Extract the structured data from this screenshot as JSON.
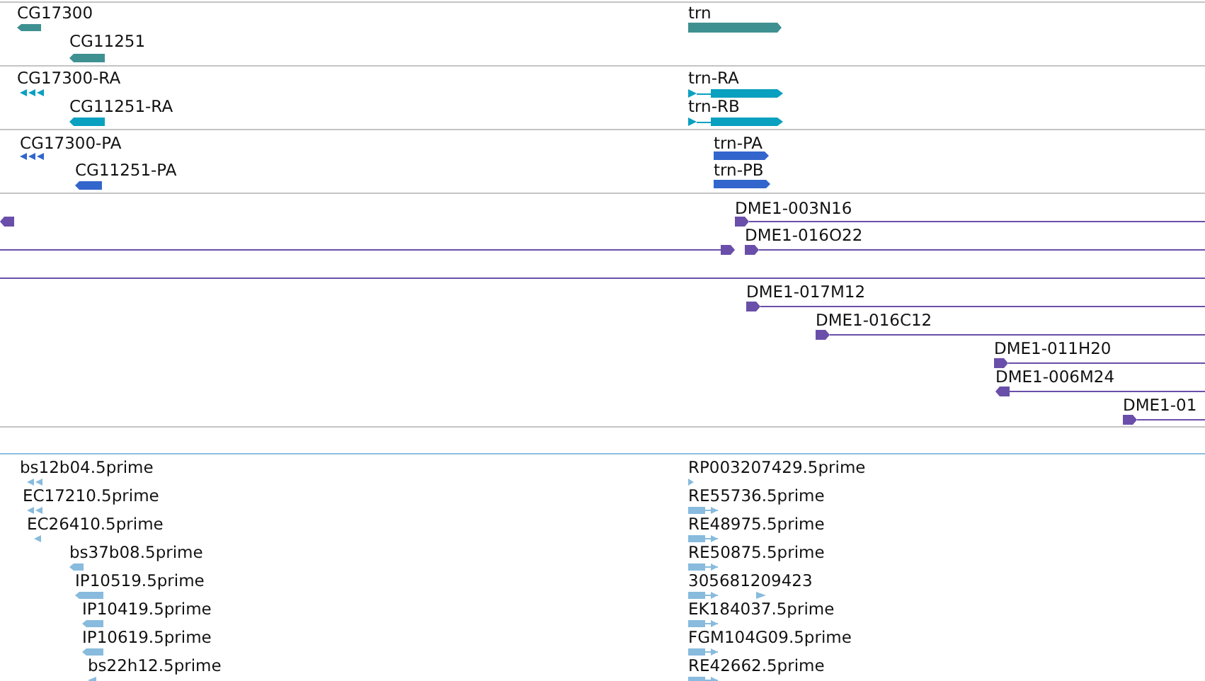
{
  "tracks": [
    {
      "kind": "gene",
      "features": [
        {
          "label": "CG17300",
          "reverse": true
        },
        {
          "label": "CG11251",
          "reverse": true
        },
        {
          "label": "trn",
          "reverse": false
        }
      ]
    },
    {
      "kind": "mrna",
      "features": [
        {
          "label": "CG17300-RA",
          "reverse": true
        },
        {
          "label": "CG11251-RA",
          "reverse": true
        },
        {
          "label": "trn-RA",
          "reverse": false
        },
        {
          "label": "trn-RB",
          "reverse": false
        }
      ]
    },
    {
      "kind": "protein",
      "features": [
        {
          "label": "CG17300-PA",
          "reverse": true
        },
        {
          "label": "CG11251-PA",
          "reverse": true
        },
        {
          "label": "trn-PA",
          "reverse": false
        },
        {
          "label": "trn-PB",
          "reverse": false
        }
      ]
    },
    {
      "kind": "clone",
      "features": [
        {
          "reverse": true
        },
        {
          "label": "DME1-003N16",
          "reverse": false
        },
        {
          "reverse": false
        },
        {
          "label": "DME1-016O22",
          "reverse": false
        },
        {
          "arrow": false
        },
        {
          "label": "DME1-017M12",
          "reverse": false
        },
        {
          "label": "DME1-016C12",
          "reverse": false
        },
        {
          "label": "DME1-011H20",
          "reverse": false
        },
        {
          "label": "DME1-006M24",
          "reverse": true
        },
        {
          "label": "DME1-01",
          "reverse": false
        }
      ]
    },
    {
      "kind": "est",
      "features": [
        {
          "label": "bs12b04.5prime",
          "reverse": true
        },
        {
          "label": "EC17210.5prime",
          "reverse": true
        },
        {
          "label": "EC26410.5prime",
          "reverse": true
        },
        {
          "label": "bs37b08.5prime",
          "reverse": true
        },
        {
          "label": "IP10519.5prime",
          "reverse": true
        },
        {
          "label": "IP10419.5prime",
          "reverse": true
        },
        {
          "label": "IP10619.5prime",
          "reverse": true
        },
        {
          "label": "bs22h12.5prime",
          "reverse": true
        },
        {
          "label": "RP003207429.5prime",
          "reverse": false
        },
        {
          "label": "RE55736.5prime",
          "reverse": false
        },
        {
          "label": "RE48975.5prime",
          "reverse": false
        },
        {
          "label": "RE50875.5prime",
          "reverse": false
        },
        {
          "label": "305681209423",
          "reverse": false
        },
        {
          "label": "EK184037.5prime",
          "reverse": false
        },
        {
          "label": "FGM104G09.5prime",
          "reverse": false
        },
        {
          "label": "RE42662.5prime",
          "reverse": false
        }
      ]
    }
  ]
}
